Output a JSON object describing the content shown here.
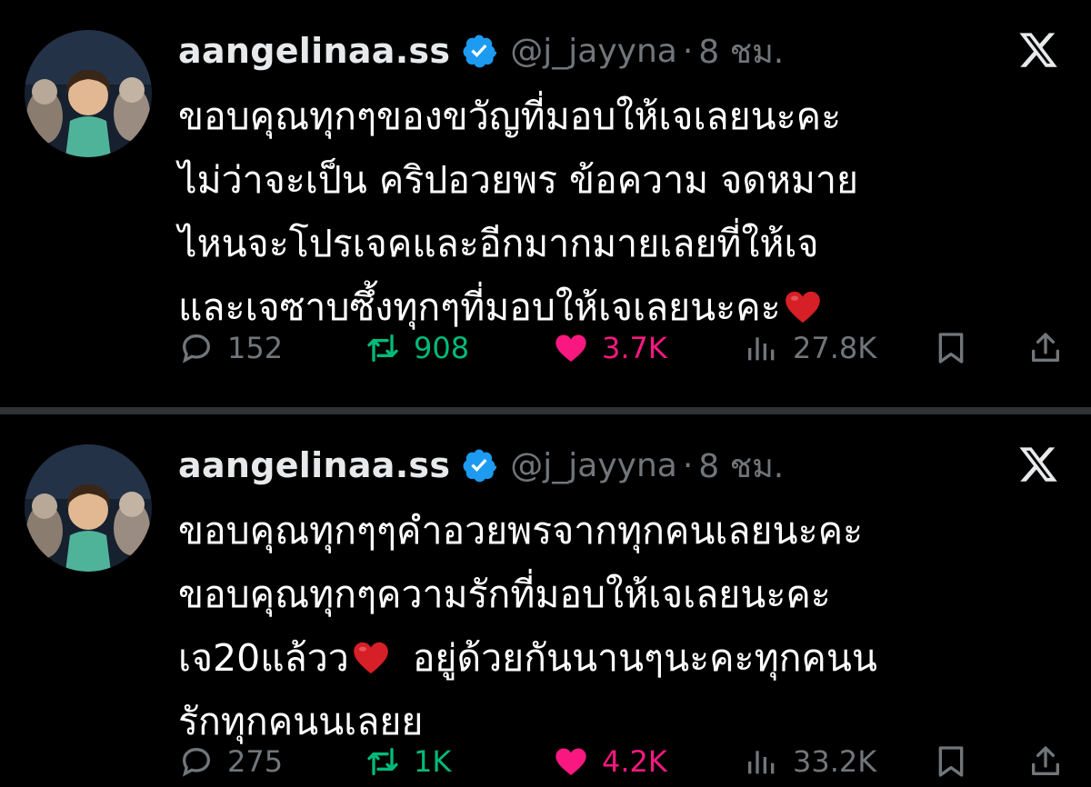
{
  "tweets": [
    {
      "display_name": "aangelinaa.ss",
      "handle": "@j_jayyna",
      "separator": "·",
      "time": "8 ชม.",
      "lines": [
        "ขอบคุณทุกๆของขวัญที่มอบให้เจเลยนะคะ",
        "ไม่ว่าจะเป็น คริปอวยพร ข้อความ จดหมาย",
        "ไหนจะโปรเจคและอีกมากมายเลยที่ให้เจ",
        "และเจซาบซึ้งทุกๆที่มอบให้เจเลยนะคะ"
      ],
      "stats": {
        "replies": "152",
        "reposts": "908",
        "likes": "3.7K",
        "views": "27.8K"
      }
    },
    {
      "display_name": "aangelinaa.ss",
      "handle": "@j_jayyna",
      "separator": "·",
      "time": "8 ชม.",
      "lines": [
        "ขอบคุณทุกๆๆคำอวยพรจากทุกคนเลยนะคะ",
        "ขอบคุณทุกๆความรักที่มอบให้เจเลยนะคะ",
        "เจ20แล้วว",
        "อยู่ด้วยกันนานๆนะคะทุกคนน",
        "รักทุกคนนเลยย"
      ],
      "stats": {
        "replies": "275",
        "reposts": "1K",
        "likes": "4.2K",
        "views": "33.2K"
      }
    }
  ],
  "icons": {
    "verified": "verified-badge-icon",
    "x_logo": "x-logo-icon",
    "reply": "reply-icon",
    "repost": "repost-icon",
    "like": "heart-icon",
    "views": "views-chart-icon",
    "bookmark": "bookmark-icon",
    "share": "share-icon",
    "emoji": "red-heart-emoji"
  },
  "colors": {
    "background": "#000000",
    "text": "#e7e9ea",
    "muted": "#71767b",
    "repost_green": "#00ba7c",
    "like_pink": "#f91880",
    "verified_blue": "#1d9bf0",
    "divider": "#2f3336"
  }
}
